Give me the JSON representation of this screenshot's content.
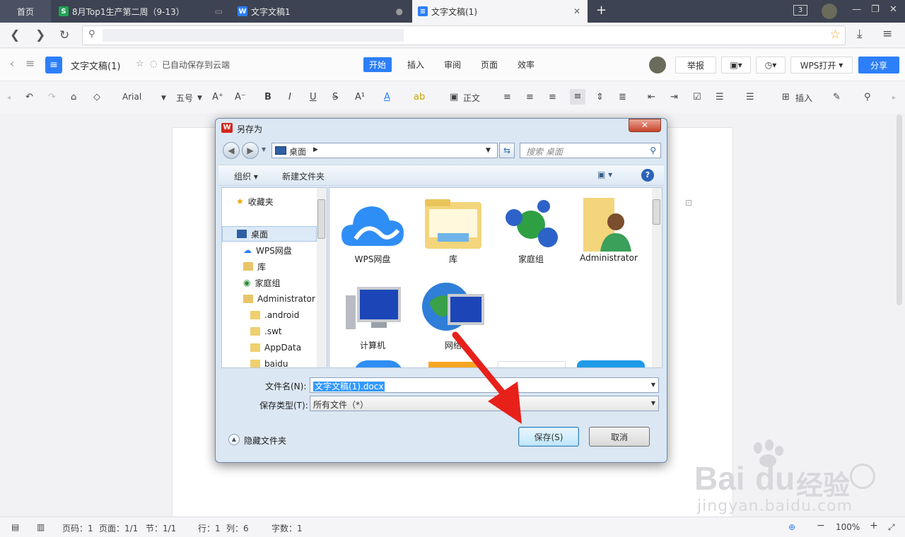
{
  "tabs": [
    {
      "label": "首页"
    },
    {
      "label": "8月Top1生产第二周（9-13）"
    },
    {
      "label": "文字文稿1"
    },
    {
      "label": "文字文稿(1)"
    }
  ],
  "window": {
    "tab_count": "3"
  },
  "document": {
    "title": "文字文稿(1)",
    "autosave": "已自动保存到云端",
    "menus": [
      "开始",
      "插入",
      "审阅",
      "页面",
      "效率"
    ],
    "report": "举报",
    "wps_open": "WPS打开",
    "share": "分享"
  },
  "toolbar": {
    "font": "Arial",
    "size": "五号",
    "style": "正文",
    "insert": "插入"
  },
  "dialog": {
    "title": "另存为",
    "path": "桌面",
    "search_placeholder": "搜索 桌面",
    "organize": "组织",
    "new_folder": "新建文件夹",
    "nav": [
      "收藏夹",
      "桌面",
      "WPS网盘",
      "库",
      "家庭组",
      "Administrator",
      ".android",
      ".swt",
      "AppData",
      "baidu"
    ],
    "files": [
      "WPS网盘",
      "库",
      "家庭组",
      "Administrator",
      "计算机",
      "网络"
    ],
    "filename_label": "文件名(N):",
    "filename": "文字文稿(1).docx",
    "filetype_label": "保存类型(T):",
    "filetype": "所有文件（*）",
    "hide_folders": "隐藏文件夹",
    "save": "保存(S)",
    "cancel": "取消"
  },
  "status": {
    "page_no": "页码：1",
    "pages": "页面：1/1",
    "section": "节：1/1",
    "row": "行：1",
    "col": "列：6",
    "words": "字数：1",
    "zoom": "100%"
  },
  "watermark": {
    "brand": "Bai",
    "brand2": "du",
    "cn": "经验",
    "url": "jingyan.baidu.com"
  },
  "colors": {
    "accent": "#2d7ff9",
    "tabbar": "#3d4352",
    "arrow": "#e8201a",
    "wps_red": "#d6281e"
  }
}
